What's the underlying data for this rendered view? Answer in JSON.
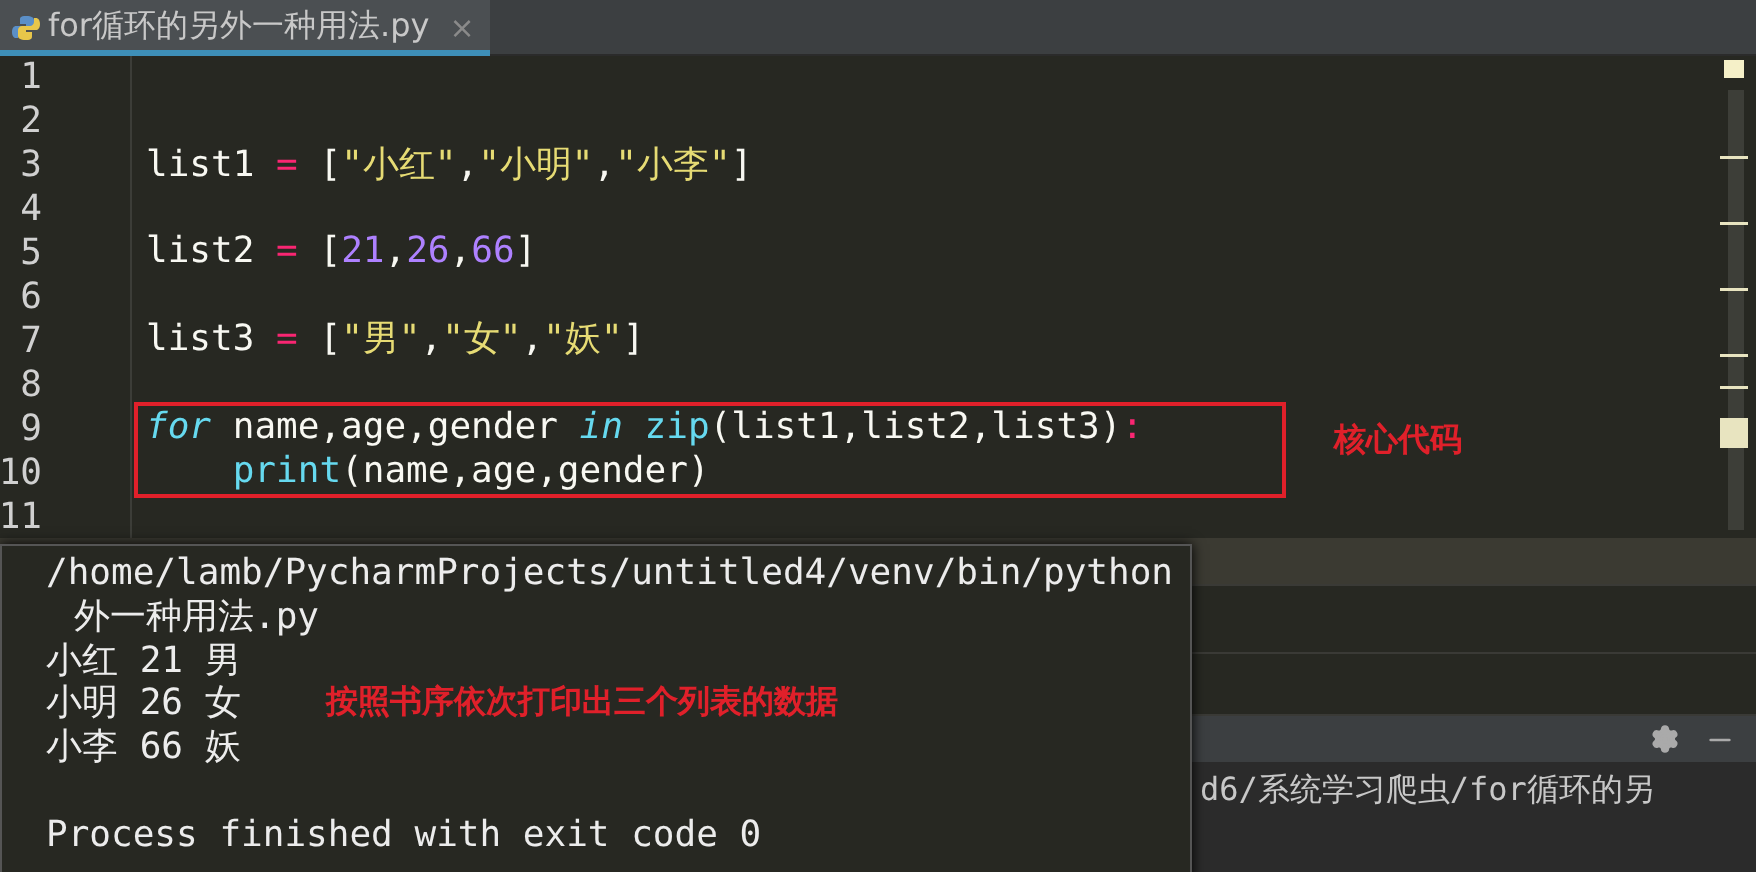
{
  "tab": {
    "label": "for循环的另外一种用法.py",
    "close": "×",
    "selected": true
  },
  "editor": {
    "box_label": "核心代码",
    "lines": [
      {
        "number": "1",
        "boxed": false
      },
      {
        "number": "2",
        "boxed": false
      },
      {
        "number": "3",
        "boxed": false,
        "tokens": [
          {
            "text": "list1 ",
            "kind": "plain"
          },
          {
            "text": "=",
            "kind": "op"
          },
          {
            "text": " [",
            "kind": "plain"
          },
          {
            "text": "\"小红\"",
            "kind": "string"
          },
          {
            "text": ",",
            "kind": "plain"
          },
          {
            "text": "\"小明\"",
            "kind": "string"
          },
          {
            "text": ",",
            "kind": "plain"
          },
          {
            "text": "\"小李\"",
            "kind": "string"
          },
          {
            "text": "]",
            "kind": "plain"
          }
        ]
      },
      {
        "number": "4",
        "boxed": false
      },
      {
        "number": "5",
        "boxed": false,
        "tokens": [
          {
            "text": "list2 ",
            "kind": "plain"
          },
          {
            "text": "=",
            "kind": "op"
          },
          {
            "text": " [",
            "kind": "plain"
          },
          {
            "text": "21",
            "kind": "number"
          },
          {
            "text": ",",
            "kind": "plain"
          },
          {
            "text": "26",
            "kind": "number"
          },
          {
            "text": ",",
            "kind": "plain"
          },
          {
            "text": "66",
            "kind": "number"
          },
          {
            "text": "]",
            "kind": "plain"
          }
        ]
      },
      {
        "number": "6",
        "boxed": false
      },
      {
        "number": "7",
        "boxed": false,
        "tokens": [
          {
            "text": "list3 ",
            "kind": "plain"
          },
          {
            "text": "=",
            "kind": "op"
          },
          {
            "text": " [",
            "kind": "plain"
          },
          {
            "text": "\"男\"",
            "kind": "string"
          },
          {
            "text": ",",
            "kind": "plain"
          },
          {
            "text": "\"女\"",
            "kind": "string"
          },
          {
            "text": ",",
            "kind": "plain"
          },
          {
            "text": "\"妖\"",
            "kind": "string"
          },
          {
            "text": "]",
            "kind": "plain"
          }
        ]
      },
      {
        "number": "8",
        "boxed": false
      },
      {
        "number": "9",
        "boxed": true,
        "tokens": [
          {
            "text": "for",
            "kind": "keyword"
          },
          {
            "text": " name,age,gender ",
            "kind": "plain"
          },
          {
            "text": "in",
            "kind": "keyword"
          },
          {
            "text": " zip",
            "kind": "builtin"
          },
          {
            "text": "(list1,list2,list3)",
            "kind": "plain"
          },
          {
            "text": ":",
            "kind": "op"
          }
        ]
      },
      {
        "number": "10",
        "boxed": true,
        "indented": true,
        "tokens": [
          {
            "text": "print",
            "kind": "builtin"
          },
          {
            "text": "(name,age,gender)",
            "kind": "plain"
          }
        ]
      },
      {
        "number": "11",
        "boxed": false
      }
    ]
  },
  "run_output": {
    "line": "d6/系统学习爬虫/for循环的另"
  },
  "console_popup": {
    "note": "按照书序依次打印出三个列表的数据",
    "lines": [
      {
        "text": "/home/lamb/PycharmProjects/untitled4/venv/bin/python",
        "indented": false
      },
      {
        "text": "外一种用法.py",
        "indented": true
      },
      {
        "text": "小红 21 男",
        "indented": false
      },
      {
        "text": "小明 26 女",
        "indented": false
      },
      {
        "text": "小李 66 妖",
        "indented": false
      },
      {
        "text": "Process finished with exit code 0",
        "indented": false
      }
    ]
  }
}
